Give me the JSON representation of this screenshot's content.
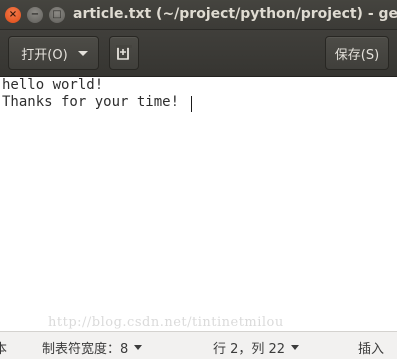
{
  "window": {
    "title": "article.txt (~/project/python/project) - gedit",
    "close_glyph": "×",
    "minimize_glyph": "−",
    "maximize_glyph": "□"
  },
  "toolbar": {
    "open_label": "打开(O)",
    "new_tab_icon": "new-document-icon",
    "save_label": "保存(S)"
  },
  "editor": {
    "lines": [
      "hello world!",
      "Thanks for your time!"
    ],
    "watermark": "http://blog.csdn.net/tintinetmilou"
  },
  "statusbar": {
    "language": "本",
    "tab_width": "制表符宽度：8",
    "position": "行 2，列 22",
    "insert_mode": "插入"
  }
}
